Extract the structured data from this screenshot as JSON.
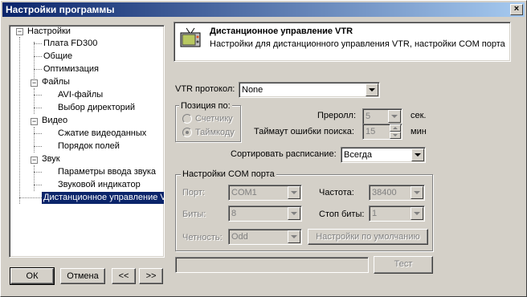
{
  "window": {
    "title": "Настройки программы",
    "close_glyph": "×"
  },
  "tree": {
    "root": "Настройки",
    "items": [
      "Плата FD300",
      "Общие",
      "Оптимизация",
      "Файлы",
      "AVI-файлы",
      "Выбор директорий",
      "Видео",
      "Сжатие видеоданных",
      "Порядок полей",
      "Звук",
      "Параметры ввода звука",
      "Звуковой индикатор",
      "Дистанционное управление VTR"
    ]
  },
  "buttons": {
    "ok": "ОК",
    "cancel": "Отмена",
    "prev": "<<",
    "next": ">>"
  },
  "header": {
    "title": "Дистанционное управление VTR",
    "subtitle": "Настройки для дистанционного управления VTR, настройки COM порта",
    "icon": "vtr-tv-icon"
  },
  "vtr": {
    "protocol_label": "VTR протокол:",
    "protocol_value": "None",
    "position_group": "Позиция по:",
    "pos_counter": "Счетчику",
    "pos_timecode": "Таймкоду",
    "preroll_label": "Преролл:",
    "preroll_value": "5",
    "preroll_unit": "сек.",
    "timeout_label": "Таймаут ошибки поиска:",
    "timeout_value": "15",
    "timeout_unit": "мин",
    "sort_label": "Сортировать расписание:",
    "sort_value": "Всегда"
  },
  "com": {
    "group": "Настройки COM порта",
    "port_label": "Порт:",
    "port_value": "COM1",
    "freq_label": "Частота:",
    "freq_value": "38400",
    "bits_label": "Биты:",
    "bits_value": "8",
    "stop_label": "Стоп биты:",
    "stop_value": "1",
    "parity_label": "Четность:",
    "parity_value": "Odd",
    "defaults_button": "Настройки по умолчанию"
  },
  "test": {
    "field_value": "",
    "button": "Тест"
  }
}
